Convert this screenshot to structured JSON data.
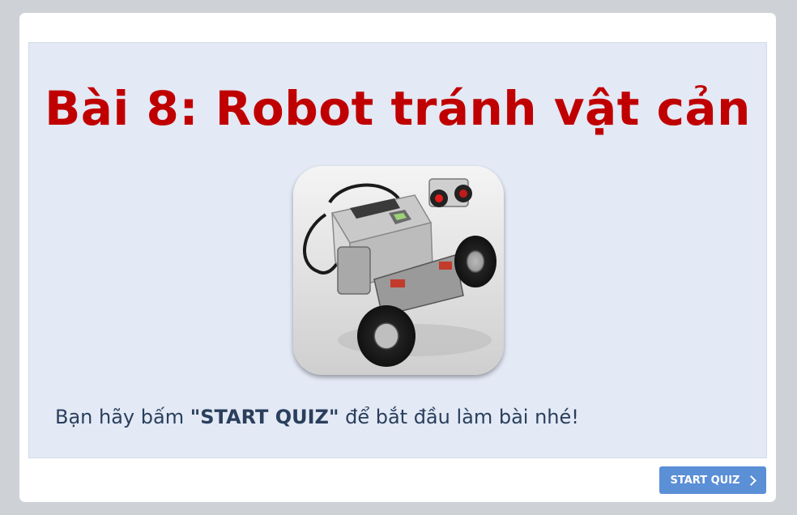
{
  "slide": {
    "title": "Bài 8: Robot tránh vật cản",
    "image_alt": "robot-photo",
    "instruction_prefix": "Bạn hãy bấm ",
    "instruction_bold": "\"START QUIZ\"",
    "instruction_suffix": " để bắt đầu làm bài nhé!"
  },
  "footer": {
    "start_label": "START QUIZ",
    "start_icon": "chevron-right-icon"
  },
  "colors": {
    "background": "#ced2d6",
    "slide_bg": "#e3e9f5",
    "title": "#c00000",
    "button": "#5b8fd6",
    "text": "#2a3f5c"
  }
}
